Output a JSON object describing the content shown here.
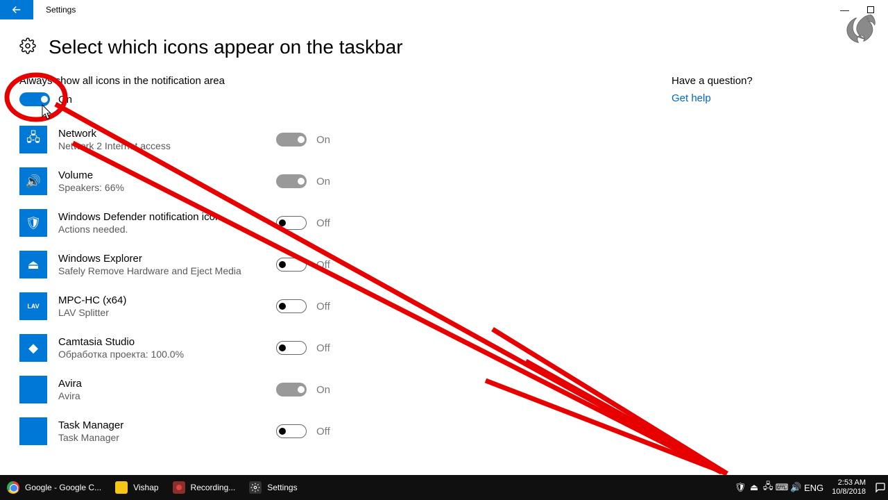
{
  "window": {
    "title": "Settings",
    "minimize": "—",
    "maximize": "□"
  },
  "header": {
    "title": "Select which icons appear on the taskbar"
  },
  "master": {
    "label": "Always show all icons in the notification area",
    "on": true,
    "state": "On"
  },
  "items": [
    {
      "title": "Network",
      "sub": "Network 2 Internet access",
      "state": "On",
      "on": true,
      "icon": "network"
    },
    {
      "title": "Volume",
      "sub": "Speakers: 66%",
      "state": "On",
      "on": true,
      "icon": "volume"
    },
    {
      "title": "Windows Defender notification icon",
      "sub": "Actions needed.",
      "state": "Off",
      "on": false,
      "icon": "defender"
    },
    {
      "title": "Windows Explorer",
      "sub": "Safely Remove Hardware and Eject Media",
      "state": "Off",
      "on": false,
      "icon": "usb"
    },
    {
      "title": "MPC-HC (x64)",
      "sub": "LAV Splitter",
      "state": "Off",
      "on": false,
      "icon": "lav"
    },
    {
      "title": "Camtasia Studio",
      "sub": "Обработка проекта: 100.0%",
      "state": "Off",
      "on": false,
      "icon": "camtasia"
    },
    {
      "title": "Avira",
      "sub": "Avira",
      "state": "On",
      "on": true,
      "icon": "avira"
    },
    {
      "title": "Task Manager",
      "sub": "Task Manager",
      "state": "Off",
      "on": false,
      "icon": "taskmgr"
    }
  ],
  "help": {
    "question": "Have a question?",
    "link": "Get help"
  },
  "taskbar": {
    "apps": [
      {
        "label": "Google - Google C...",
        "icon": "chrome"
      },
      {
        "label": "Vishap",
        "icon": "folder"
      },
      {
        "label": "Recording...",
        "icon": "rec"
      },
      {
        "label": "Settings",
        "icon": "gear"
      }
    ],
    "lang": "ENG",
    "time": "2:53 AM",
    "date": "10/8/2018"
  }
}
